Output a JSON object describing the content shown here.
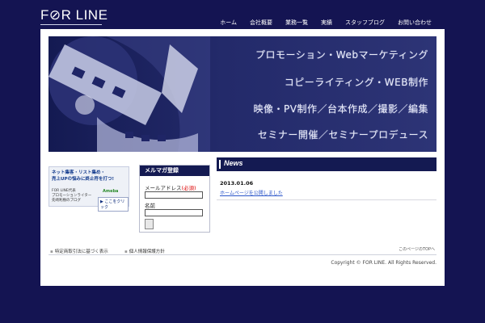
{
  "header": {
    "logo": "F⊘R LINE",
    "nav": [
      "ホーム",
      "会社概要",
      "業務一覧",
      "実績",
      "スタッフブログ",
      "お問い合わせ"
    ]
  },
  "hero": {
    "lines": [
      "プロモーション・Webマーケティング",
      "コピーライティング・WEB制作",
      "映像・PV制作／台本作成／撮影／編集",
      "セミナー開催／セミナープロデュース"
    ]
  },
  "blog_banner": {
    "headline_1": "ネット集客・リスト集め・",
    "headline_2": "売上UPの悩みに終止符を打つ!",
    "sub_1": "FOR LINE代表",
    "sub_2": "プロモーションライター",
    "sub_3": "先崎利樹のブログ",
    "ameba": "Ameba",
    "click": "▶ ここをクリック"
  },
  "mailmag": {
    "title": "メルマガ登録",
    "email_label": "メールアドレス",
    "email_required": "(必須)",
    "name_label": "名前"
  },
  "news": {
    "title": "News",
    "date": "2013.01.06",
    "link": "ホームページを公開しました"
  },
  "footer": {
    "link_1": "特定商取引法に基づく表示",
    "link_2": "個人情報保護方針",
    "to_top": "このページのTOPへ",
    "copyright": "Copyright © FOR LINE. All Rights Reserved."
  },
  "colors": {
    "background": "#141452",
    "accent_navy": "#141a52",
    "link_blue": "#2a55c9"
  }
}
